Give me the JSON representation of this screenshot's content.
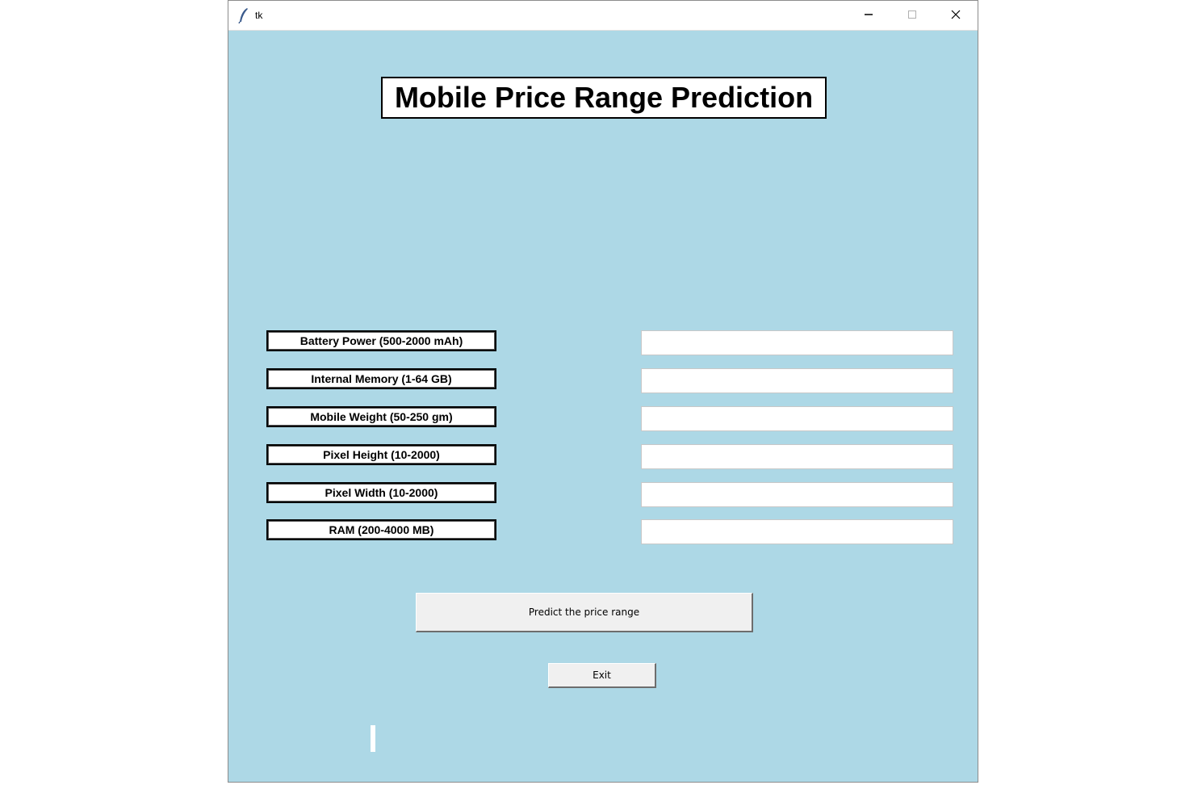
{
  "window": {
    "title": "tk",
    "icon": "feather-icon",
    "controls": {
      "minimize_icon": "minimize-icon",
      "maximize_icon": "maximize-icon",
      "close_icon": "close-icon"
    },
    "background_color": "#add8e6"
  },
  "heading": "Mobile Price Range Prediction",
  "fields": [
    {
      "label": "Battery Power (500-2000 mAh)",
      "value": ""
    },
    {
      "label": "Internal Memory (1-64 GB)",
      "value": ""
    },
    {
      "label": "Mobile Weight (50-250 gm)",
      "value": ""
    },
    {
      "label": "Pixel Height (10-2000)",
      "value": ""
    },
    {
      "label": "Pixel Width (10-2000)",
      "value": ""
    },
    {
      "label": "RAM (200-4000 MB)",
      "value": ""
    }
  ],
  "buttons": {
    "predict": "Predict the price range",
    "exit": "Exit"
  },
  "result": ""
}
